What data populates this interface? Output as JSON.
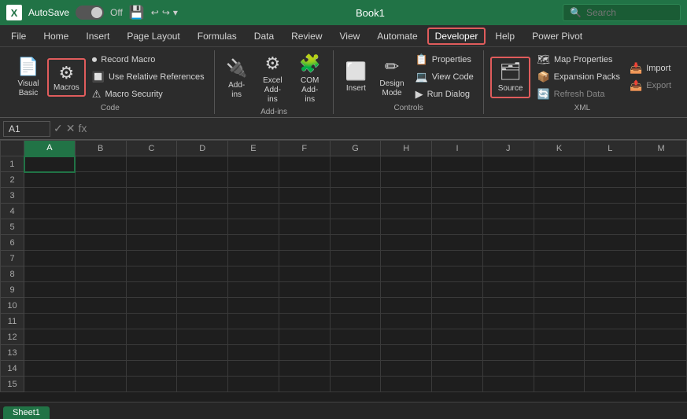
{
  "titleBar": {
    "logo": "X",
    "autoSave": "AutoSave",
    "toggleState": "Off",
    "fileName": "Book1",
    "searchPlaceholder": "Search"
  },
  "menuBar": {
    "items": [
      {
        "id": "file",
        "label": "File"
      },
      {
        "id": "home",
        "label": "Home"
      },
      {
        "id": "insert",
        "label": "Insert"
      },
      {
        "id": "pageLayout",
        "label": "Page Layout"
      },
      {
        "id": "formulas",
        "label": "Formulas"
      },
      {
        "id": "data",
        "label": "Data"
      },
      {
        "id": "review",
        "label": "Review"
      },
      {
        "id": "view",
        "label": "View"
      },
      {
        "id": "automate",
        "label": "Automate"
      },
      {
        "id": "developer",
        "label": "Developer"
      },
      {
        "id": "help",
        "label": "Help"
      },
      {
        "id": "powerPivot",
        "label": "Power Pivot"
      }
    ]
  },
  "ribbon": {
    "groups": [
      {
        "id": "code",
        "label": "Code",
        "items": [
          {
            "id": "visualBasic",
            "label": "Visual\nBasic",
            "icon": "📄",
            "size": "large"
          },
          {
            "id": "macros",
            "label": "Macros",
            "icon": "⚙",
            "size": "large",
            "highlight": true
          },
          {
            "id": "recordMacro",
            "label": "Record Macro",
            "icon": "⏺",
            "size": "small"
          },
          {
            "id": "useRelativeRefs",
            "label": "Use Relative References",
            "icon": "🔲",
            "size": "small"
          },
          {
            "id": "macroSecurity",
            "label": "Macro Security",
            "icon": "⚠",
            "size": "small"
          }
        ]
      },
      {
        "id": "addins",
        "label": "Add-ins",
        "items": [
          {
            "id": "addIns",
            "label": "Add-\nins",
            "icon": "🔌",
            "size": "large"
          },
          {
            "id": "excelAddIns",
            "label": "Excel\nAdd-ins",
            "icon": "⚙",
            "size": "large"
          },
          {
            "id": "comAddIns",
            "label": "COM\nAdd-ins",
            "icon": "🧩",
            "size": "large"
          }
        ]
      },
      {
        "id": "controls",
        "label": "Controls",
        "items": [
          {
            "id": "insert",
            "label": "Insert",
            "icon": "⬜",
            "size": "large"
          },
          {
            "id": "designMode",
            "label": "Design\nMode",
            "icon": "✏",
            "size": "large"
          },
          {
            "id": "properties",
            "label": "Properties",
            "icon": "📋",
            "size": "small"
          },
          {
            "id": "viewCode",
            "label": "View Code",
            "icon": "💻",
            "size": "small"
          },
          {
            "id": "runDialog",
            "label": "Run Dialog",
            "icon": "▶",
            "size": "small"
          }
        ]
      },
      {
        "id": "xml",
        "label": "XML",
        "items": [
          {
            "id": "source",
            "label": "Source",
            "icon": "🗂",
            "size": "large",
            "highlight": true
          },
          {
            "id": "mapProperties",
            "label": "Map Properties",
            "icon": "🗺",
            "size": "small"
          },
          {
            "id": "expansionPacks",
            "label": "Expansion Packs",
            "icon": "📦",
            "size": "small"
          },
          {
            "id": "refreshData",
            "label": "Refresh Data",
            "icon": "🔄",
            "size": "small"
          },
          {
            "id": "import",
            "label": "Import",
            "icon": "📥",
            "size": "small"
          },
          {
            "id": "export",
            "label": "Export",
            "icon": "📤",
            "size": "small"
          }
        ]
      }
    ]
  },
  "formulaBar": {
    "cellRef": "A1",
    "formula": ""
  },
  "spreadsheet": {
    "columns": [
      "A",
      "B",
      "C",
      "D",
      "E",
      "F",
      "G",
      "H",
      "I",
      "J",
      "K",
      "L",
      "M"
    ],
    "rowCount": 15,
    "activeCell": "A1"
  },
  "sheetTabs": [
    {
      "id": "sheet1",
      "label": "Sheet1",
      "active": true
    }
  ]
}
